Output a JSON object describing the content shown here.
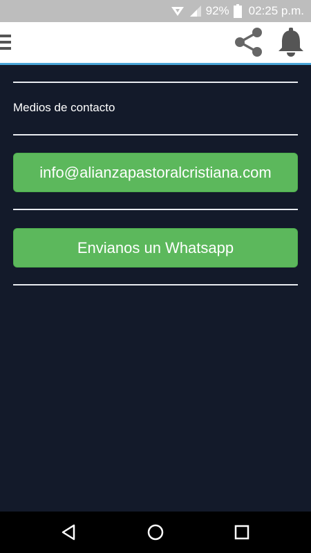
{
  "status_bar": {
    "battery_percent": "92%",
    "time": "02:25 p.m.",
    "icons": [
      "data-saver-icon",
      "signal-icon",
      "battery-icon"
    ]
  },
  "app_bar": {
    "icons": [
      "menu-icon",
      "share-icon",
      "bell-icon"
    ],
    "accent_color": "#4aa6d9"
  },
  "main": {
    "section_label": "Medios de contacto",
    "email_button_label": "info@alianzapastoralcristiana.com",
    "whatsapp_button_label": "Envianos un Whatsapp",
    "button_color": "#5cb85c",
    "background_color": "#131a2a"
  },
  "nav_bar": {
    "icons": [
      "back-icon",
      "home-icon",
      "recents-icon"
    ]
  }
}
